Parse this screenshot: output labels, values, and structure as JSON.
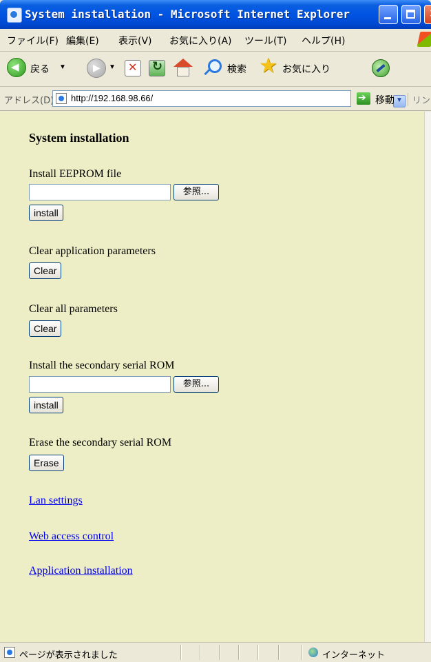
{
  "window": {
    "title": "System installation - Microsoft Internet Explorer"
  },
  "menu": [
    "ファイル(F)",
    "編集(E)",
    "表示(V)",
    "お気に入り(A)",
    "ツール(T)",
    "ヘルプ(H)"
  ],
  "toolbar": {
    "back_label": "戻る",
    "search_label": "検索",
    "favorites_label": "お気に入り"
  },
  "address": {
    "label": "アドレス(D)",
    "url": "http://192.168.98.66/",
    "go_label": "移動",
    "links_label": "リンク"
  },
  "page": {
    "title": "System installation",
    "install_eeprom_label": "Install EEPROM file",
    "browse_label": "参照...",
    "install_label": "install",
    "clear_app_label": "Clear application parameters",
    "clear_label": "Clear",
    "clear_all_label": "Clear all parameters",
    "secondary_install_label": "Install the secondary serial ROM",
    "erase_label_text": "Erase the secondary serial ROM",
    "erase_button_label": "Erase",
    "links": [
      "Lan settings",
      "Web access control",
      "Application installation"
    ]
  },
  "status": {
    "text": "ページが表示されました",
    "zone": "インターネット"
  },
  "colors": {
    "content_bg": "#ededc6",
    "link": "#0000ee",
    "title_bar": "#0054e3"
  }
}
